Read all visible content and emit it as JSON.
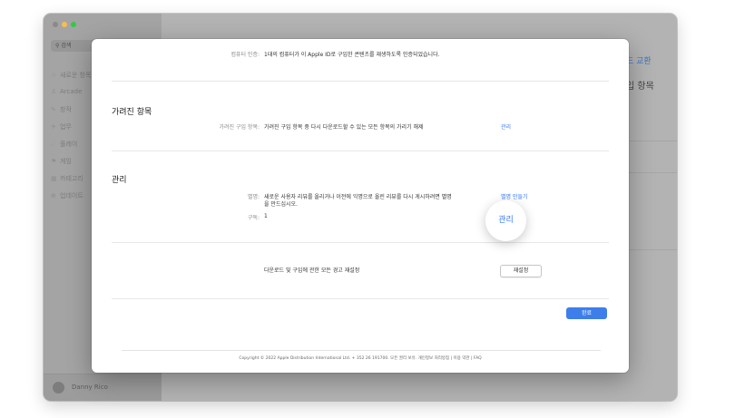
{
  "sidebar": {
    "search_placeholder": "검색",
    "items": [
      {
        "icon": "star-icon",
        "glyph": "☆",
        "label": "새로운 항목"
      },
      {
        "icon": "arcade-icon",
        "glyph": "♙",
        "label": "Arcade"
      },
      {
        "icon": "create-icon",
        "glyph": "✎",
        "label": "창작"
      },
      {
        "icon": "work-icon",
        "glyph": "✈",
        "label": "업무"
      },
      {
        "icon": "play-icon",
        "glyph": "☄",
        "label": "플레이"
      },
      {
        "icon": "game-icon",
        "glyph": "⚑",
        "label": "게임"
      },
      {
        "icon": "category-icon",
        "glyph": "▦",
        "label": "카테고리"
      },
      {
        "icon": "updates-icon",
        "glyph": "⊕",
        "label": "업데이트"
      }
    ],
    "user_name": "Danny Rico"
  },
  "background": {
    "peek_link": "드 교환",
    "peek_title": "입 항목"
  },
  "modal": {
    "authorization": {
      "label": "컴퓨터 인증:",
      "text": "1대의 컴퓨터가 이 Apple ID로 구입한 콘텐츠를 재생하도록 인증되었습니다."
    },
    "hidden_section": {
      "heading": "가려진 항목",
      "label": "가려진 구입 항목:",
      "text": "가려진 구입 항목 중 다시 다운로드할 수 있는 모든 항목의 가리기 해제",
      "action": "관리"
    },
    "manage_section": {
      "heading": "관리",
      "nickname_label": "별명:",
      "nickname_text_line1": "새로운 사용자 리뷰를 올리거나 이전에 익명으로 올린 리뷰를 다시 게시하려면 별명",
      "nickname_text_line2": "을 만드십시오.",
      "nickname_action": "별명 만들기",
      "subscriptions_label": "구독:",
      "subscriptions_value": "1",
      "subscriptions_action": "관리"
    },
    "reset_section": {
      "text": "다운로드 및 구입에 관한 모든 경고 재설정",
      "button": "재설정"
    },
    "done_button": "완료",
    "footer": "Copyright © 2022 Apple Distribution International Ltd. + 352 26 191700. 모든 권리 보유.   개인정보 처리방침  |  이용 약관  |  FAQ"
  }
}
